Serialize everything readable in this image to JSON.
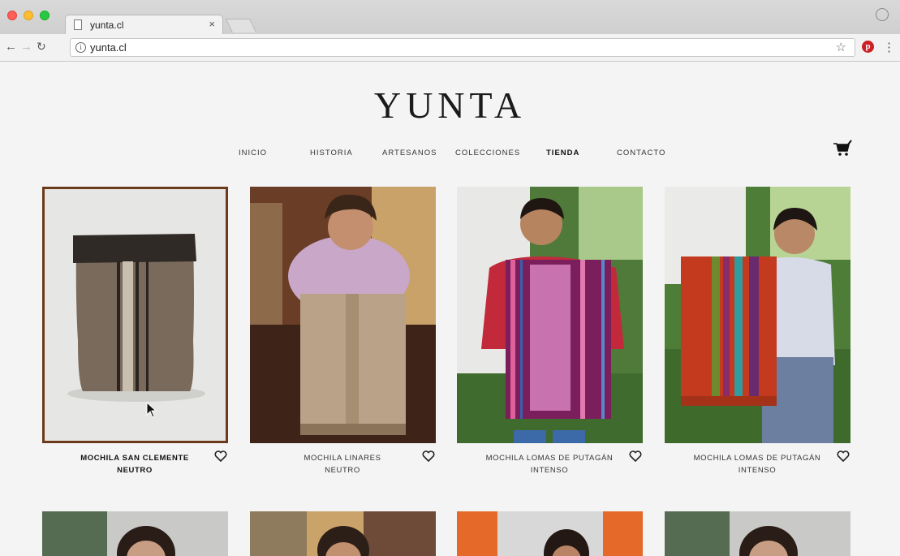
{
  "browser": {
    "tab_title": "yunta.cl",
    "tab_close": "×",
    "url": "yunta.cl",
    "info_glyph": "i",
    "pinterest_glyph": "p"
  },
  "site": {
    "logo": "YUNTA",
    "nav": [
      {
        "label": "INICIO",
        "active": false
      },
      {
        "label": "HISTORIA",
        "active": false
      },
      {
        "label": "ARTESANOS",
        "active": false
      },
      {
        "label": "COLECCIONES",
        "active": false
      },
      {
        "label": "TIENDA",
        "active": true
      },
      {
        "label": "CONTACTO",
        "active": false
      }
    ]
  },
  "products": [
    {
      "line1": "MOCHILA SAN CLEMENTE",
      "line2": "NEUTRO",
      "selected": true
    },
    {
      "line1": "MOCHILA LINARES",
      "line2": "NEUTRO",
      "selected": false
    },
    {
      "line1": "MOCHILA LOMAS DE PUTAGÁN",
      "line2": "INTENSO",
      "selected": false
    },
    {
      "line1": "MOCHILA LOMAS DE PUTAGÁN",
      "line2": "INTENSO",
      "selected": false
    }
  ],
  "colors": {
    "selected_border": "#6b3a1a",
    "pinterest": "#cb2027"
  }
}
